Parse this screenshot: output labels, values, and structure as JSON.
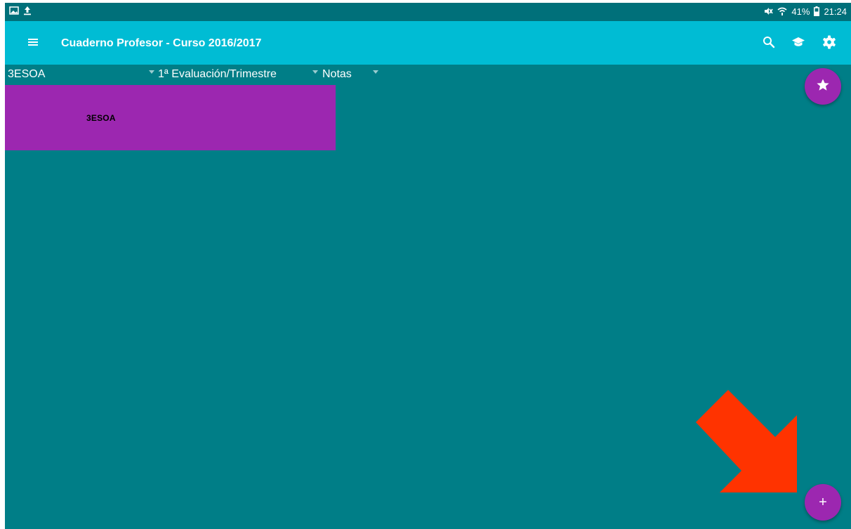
{
  "status_bar": {
    "left_icons": [
      "image-icon",
      "upload-icon"
    ],
    "right_icons": [
      "mute-icon",
      "wifi-icon",
      "battery-icon"
    ],
    "battery": "41%",
    "time": "21:24"
  },
  "app_bar": {
    "title": "Cuaderno Profesor - Curso 2016/2017",
    "actions": [
      "search-icon",
      "graduation-cap-icon",
      "gear-icon"
    ]
  },
  "filters": {
    "group": "3ESOA",
    "evaluation": "1ª Evaluación/Trimestre",
    "view": "Notas"
  },
  "group_card": {
    "label": "3ESOA",
    "color": "#9C27B0"
  },
  "fabs": {
    "favorites_icon": "star-icon",
    "add_label": "+",
    "color": "#9C27B0"
  },
  "colors": {
    "background": "#007E87",
    "app_bar": "#00BCD4",
    "status_bar": "#00707A",
    "annotation_arrow": "#FF3300"
  }
}
